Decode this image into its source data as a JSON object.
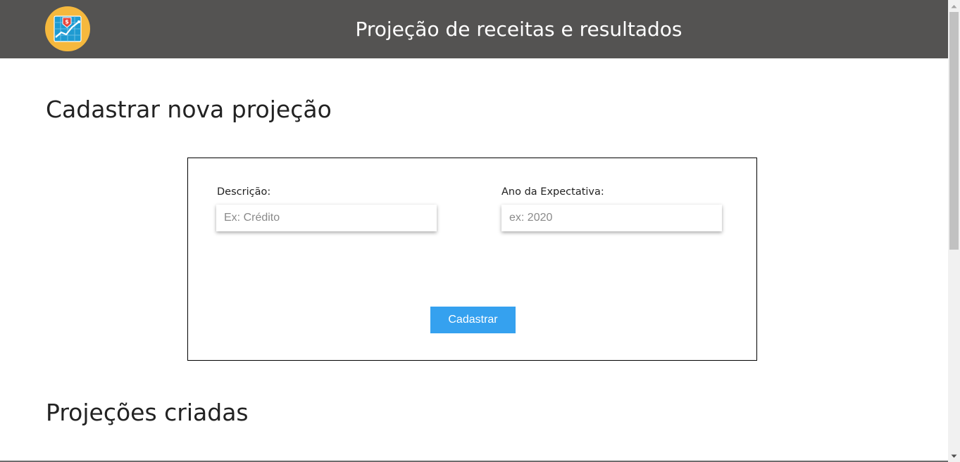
{
  "header": {
    "title": "Projeção de receitas e resultados",
    "logo_icon": "chart-growth-logo-icon"
  },
  "new_projection": {
    "title": "Cadastrar nova projeção",
    "description_label": "Descrição:",
    "description_placeholder": "Ex: Crédito",
    "description_value": "",
    "year_label": "Ano da Expectativa:",
    "year_placeholder": "ex: 2020",
    "year_value": "",
    "submit_label": "Cadastrar"
  },
  "projections": {
    "title": "Projeções criadas"
  },
  "colors": {
    "header_bg": "#545352",
    "accent": "#35a1ef",
    "logo_circle": "#f5b83d",
    "logo_screen": "#1f9bd1"
  }
}
